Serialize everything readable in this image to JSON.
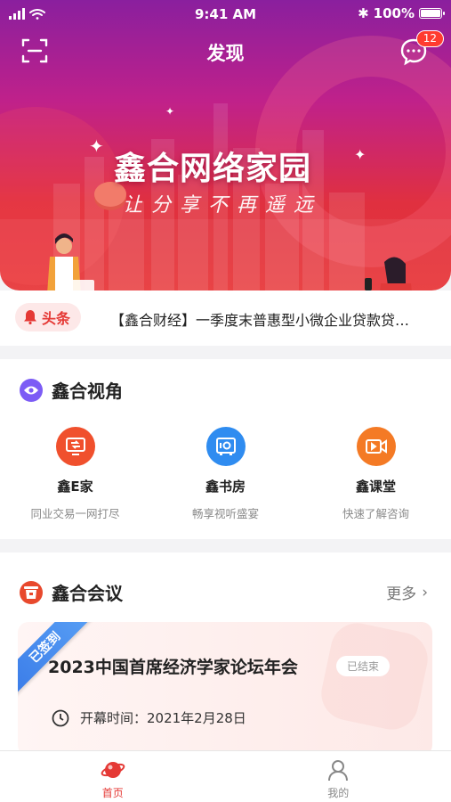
{
  "status_bar": {
    "time": "9:41 AM",
    "battery": "100%"
  },
  "nav": {
    "title": "发现",
    "message_count": "12"
  },
  "banner": {
    "title": "鑫合网络家园",
    "slogan": "让分享不再遥远"
  },
  "headline": {
    "tag": "头条",
    "text": "【鑫合财经】一季度末普惠型小微企业贷款贷…"
  },
  "perspective": {
    "title": "鑫合视角",
    "items": [
      {
        "name": "鑫E家",
        "desc": "同业交易一网打尽",
        "icon": "monitor-icon",
        "color": "#f0502d"
      },
      {
        "name": "鑫书房",
        "desc": "畅享视听盛宴",
        "icon": "safe-icon",
        "color": "#2f8cf0"
      },
      {
        "name": "鑫课堂",
        "desc": "快速了解咨询",
        "icon": "video-icon",
        "color": "#f47a25"
      }
    ]
  },
  "meetings": {
    "title": "鑫合会议",
    "more_label": "更多",
    "item": {
      "ribbon": "已签到",
      "title": "2023中国首席经济学家论坛年会",
      "status": "已结束",
      "time_text": "开幕时间：2021年2月28日"
    }
  },
  "tabbar": {
    "tabs": [
      {
        "label": "首页",
        "active": true
      },
      {
        "label": "我的",
        "active": false
      }
    ]
  },
  "colors": {
    "accent": "#e53935",
    "brand_purple": "#8a1f9e"
  }
}
